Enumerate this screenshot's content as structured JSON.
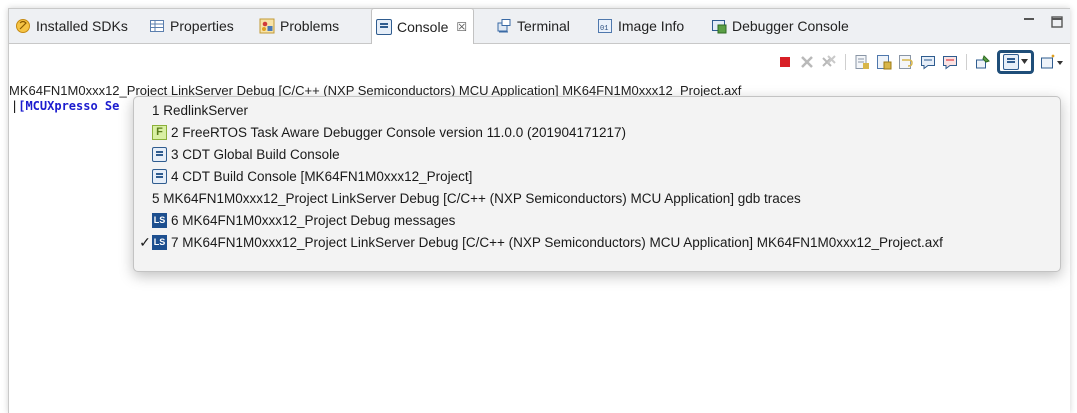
{
  "tabs": [
    {
      "label": "Installed SDKs",
      "icon": "sdk-icon"
    },
    {
      "label": "Properties",
      "icon": "properties-icon"
    },
    {
      "label": "Problems",
      "icon": "problems-icon"
    },
    {
      "label": "Console",
      "icon": "console-icon",
      "active": true,
      "close": "☒"
    },
    {
      "label": "Terminal",
      "icon": "terminal-icon"
    },
    {
      "label": "Image Info",
      "icon": "image-info-icon"
    },
    {
      "label": "Debugger Console",
      "icon": "debugger-console-icon"
    }
  ],
  "window_controls": {
    "minimize": "▭",
    "maximize": "▭"
  },
  "console": {
    "title": "MK64FN1M0xxx12_Project LinkServer Debug [C/C++ (NXP Semiconductors) MCU Application] MK64FN1M0xxx12_Project.axf",
    "title_prefix": "MK64FN1M0xxx1",
    "first_line": "[MCUXpresso Se"
  },
  "menu": {
    "items": [
      {
        "label": "1 RedlinkServer",
        "icon": "",
        "checked": false
      },
      {
        "label": "2 FreeRTOS Task Aware Debugger Console version 11.0.0 (201904171217)",
        "icon": "freertos-icon",
        "icon_text": "F",
        "checked": false
      },
      {
        "label": "3 CDT Global Build Console",
        "icon": "console-icon",
        "checked": false
      },
      {
        "label": "4 CDT Build Console [MK64FN1M0xxx12_Project]",
        "icon": "console-icon",
        "checked": false
      },
      {
        "label": "5 MK64FN1M0xxx12_Project LinkServer Debug [C/C++ (NXP Semiconductors) MCU Application] gdb traces",
        "icon": "",
        "checked": false
      },
      {
        "label": "6 MK64FN1M0xxx12_Project Debug messages",
        "icon": "linkserver-icon",
        "icon_text": "LS",
        "checked": false
      },
      {
        "label": "7 MK64FN1M0xxx12_Project LinkServer Debug [C/C++ (NXP Semiconductors) MCU Application] MK64FN1M0xxx12_Project.axf",
        "icon": "linkserver-icon",
        "icon_text": "LS",
        "checked": true,
        "check_mark": "✓"
      }
    ]
  },
  "colors": {
    "accent": "#1f4e79",
    "terminate_red": "#d81f26",
    "console_blue": "#1c1ccf"
  }
}
